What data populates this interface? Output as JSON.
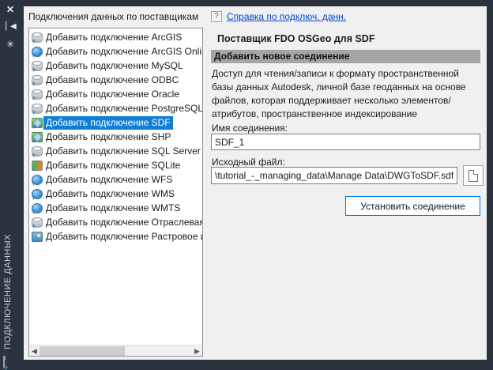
{
  "colors": {
    "frame_dark": "#2b333f",
    "panel_bg": "#f0f0f0",
    "selection_blue": "#0f7fd8",
    "section_band_gray": "#a5a5a5",
    "link_blue": "#0645cc",
    "button_border_blue": "#0078d7"
  },
  "dock": {
    "title": "ПОДКЛЮЧЕНИЕ ДАННЫХ",
    "close_glyph": "✕",
    "pin_glyph": "▏◀",
    "gear_glyph": "✳"
  },
  "panel": {
    "header": "Подключения данных по поставщикам",
    "help": {
      "icon_glyph": "?",
      "link_label": "Справка по подключ. данн."
    },
    "provider_title": "Поставщик FDO OSGeo для SDF",
    "section_header": "Добавить новое соединение",
    "description": "Доступ для чтения/записи к формату пространственной базы данных Autodesk, личной базе геоданных на основе файлов, которая поддерживает несколько элементов/атрибутов, пространственное индексирование",
    "name_label": "Имя соединения:",
    "name_value": "SDF_1",
    "file_label": "Исходный файл:",
    "file_value": "\\tutorial_-_managing_data\\Manage Data\\DWGToSDF.sdf",
    "connect_button_label": "Установить соединение"
  },
  "list": {
    "scroll_left_glyph": "◀",
    "scroll_right_glyph": "▶",
    "items": [
      {
        "label": "Добавить подключение ArcGIS",
        "icon": "db",
        "selected": false
      },
      {
        "label": "Добавить подключение ArcGIS Onlin",
        "icon": "globe",
        "selected": false
      },
      {
        "label": "Добавить подключение MySQL",
        "icon": "db",
        "selected": false
      },
      {
        "label": "Добавить подключение ODBC",
        "icon": "db",
        "selected": false
      },
      {
        "label": "Добавить подключение Oracle",
        "icon": "db",
        "selected": false
      },
      {
        "label": "Добавить подключение PostgreSQL",
        "icon": "db",
        "selected": false
      },
      {
        "label": "Добавить подключение SDF",
        "icon": "layers",
        "selected": true
      },
      {
        "label": "Добавить подключение SHP",
        "icon": "layers",
        "selected": false
      },
      {
        "label": "Добавить подключение SQL Server S",
        "icon": "db",
        "selected": false
      },
      {
        "label": "Добавить подключение SQLite",
        "icon": "sqlite",
        "selected": false
      },
      {
        "label": "Добавить подключение WFS",
        "icon": "globe",
        "selected": false
      },
      {
        "label": "Добавить подключение WMS",
        "icon": "globe",
        "selected": false
      },
      {
        "label": "Добавить подключение WMTS",
        "icon": "globe",
        "selected": false
      },
      {
        "label": "Добавить подключение Отраслевая",
        "icon": "db",
        "selected": false
      },
      {
        "label": "Добавить подключение Растровое и",
        "icon": "raster",
        "selected": false
      }
    ]
  }
}
